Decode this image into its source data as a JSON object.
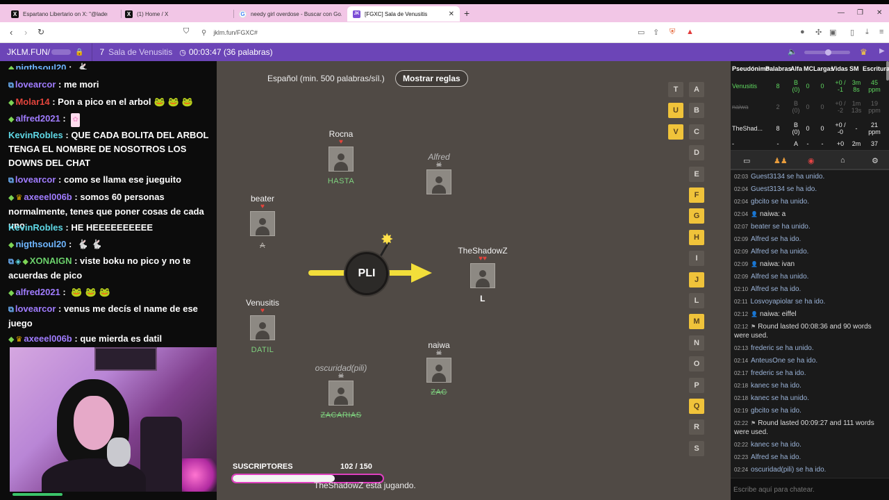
{
  "browser": {
    "tabs": [
      {
        "title": "Espartano Libertario on X: \"@ladere...",
        "icon": "x-logo"
      },
      {
        "title": "(1) Home / X",
        "icon": "x-logo"
      },
      {
        "title": "needy girl overdose - Buscar con Go...",
        "icon": "google-logo"
      },
      {
        "title": "[FGXC] Sala de Venusitis",
        "icon": "jklm-logo"
      }
    ],
    "new_tab": "+",
    "url": "jklm.fun/FGXC#"
  },
  "room_header": {
    "brand": "JKLM.FUN/",
    "room_number": "7",
    "room_name": "Sala de Venusitis",
    "timer": "00:03:47 (36 palabras)"
  },
  "chat_overlay": {
    "messages": [
      {
        "user": "nigthsoul20",
        "text": "",
        "emotes": [
          "bunny"
        ],
        "color": "blue"
      },
      {
        "user": "lovearcor",
        "text": "me mori",
        "emotes": [],
        "color": "purple"
      },
      {
        "user": "Molar14",
        "text": "Pon a pico en el arbol",
        "emotes": [
          "pepe",
          "pepe",
          "pepe"
        ],
        "color": "red"
      },
      {
        "user": "alfred2021",
        "text": "",
        "emotes": [
          "kitty"
        ],
        "color": "purple"
      },
      {
        "user": "KevinRobles",
        "text": "QUE CADA BOLITA DEL ARBOL TENGA EL NOMBRE DE NOSOTROS LOS DOWNS DEL CHAT",
        "emotes": [],
        "color": "cyan"
      },
      {
        "user": "lovearcor",
        "text": "como se llama ese jueguito",
        "emotes": [],
        "color": "purple"
      },
      {
        "user": "axeeel006b",
        "text": "somos 60 personas normalmente, tenes que poner cosas de cada uno",
        "emotes": [],
        "color": "purple"
      },
      {
        "user": "KevinRobles",
        "text": "HE HEEEEEEEEEE",
        "emotes": [],
        "color": "cyan"
      },
      {
        "user": "nigthsoul20",
        "text": "",
        "emotes": [
          "bunny",
          "bunny"
        ],
        "color": "blue"
      },
      {
        "user": "XONAIGN",
        "text": "viste boku no pico y no te acuerdas de pico",
        "emotes": [],
        "color": "green"
      },
      {
        "user": "alfred2021",
        "text": "",
        "emotes": [
          "frog",
          "frog",
          "frog"
        ],
        "color": "purple"
      },
      {
        "user": "lovearcor",
        "text": "venus me decís el name de ese juego",
        "emotes": [],
        "color": "purple"
      },
      {
        "user": "axeeel006b",
        "text": "que mierda es datil",
        "emotes": [],
        "color": "purple"
      }
    ]
  },
  "game": {
    "language_rule": "Español (min. 500 palabras/síl.)",
    "rules_button": "Mostrar reglas",
    "syllable": "PLI",
    "players": [
      {
        "name": "Rocna",
        "lives": 1,
        "word": "HASTA",
        "state": "alive"
      },
      {
        "name": "Alfred",
        "lives": 0,
        "word": "",
        "state": "dead"
      },
      {
        "name": "beater",
        "lives": 1,
        "word": "A",
        "state": "alive"
      },
      {
        "name": "TheShadowZ",
        "lives": 2,
        "word": "L",
        "state": "current"
      },
      {
        "name": "Venusitis",
        "lives": 1,
        "word": "DATIL",
        "state": "alive"
      },
      {
        "name": "naiwa",
        "lives": 0,
        "word": "ZAC",
        "state": "dead"
      },
      {
        "name": "oscuridad(pili)",
        "lives": 0,
        "word": "ZACARIAS",
        "state": "dead"
      }
    ],
    "subscribers": {
      "label": "SUSCRIPTORES",
      "count": "102  / 150",
      "progress": 0.68
    },
    "status_text": "TheShadowZ está jugando.",
    "bonus_letters": [
      "T",
      "U",
      "V"
    ],
    "letters": [
      "A",
      "B",
      "C",
      "D",
      "E",
      "F",
      "G",
      "H",
      "I",
      "J",
      "L",
      "M",
      "N",
      "O",
      "P",
      "Q",
      "R",
      "S"
    ],
    "letters_on": [
      "U",
      "V",
      "F",
      "G",
      "H",
      "J",
      "M",
      "Q"
    ]
  },
  "scoreboard": {
    "headers": [
      "Pseudónimo",
      "Palabras",
      "Alfa",
      "MC",
      "Largas",
      "Vidas",
      "SM",
      "Escritura"
    ],
    "rows": [
      {
        "name": "Venusitis",
        "palabras": "8",
        "alfa": "B (0)",
        "mc": "0",
        "largas": "0",
        "vidas": "+0 / -1",
        "sm": "3m 8s",
        "escritura": "45 ppm",
        "style": "lead"
      },
      {
        "name": "naiwa",
        "palabras": "2",
        "alfa": "B (0)",
        "mc": "0",
        "largas": "0",
        "vidas": "+0 / -2",
        "sm": "1m 13s",
        "escritura": "19 ppm",
        "style": "gone"
      },
      {
        "name": "TheShad...",
        "palabras": "8",
        "alfa": "B (0)",
        "mc": "0",
        "largas": "0",
        "vidas": "+0 / -0",
        "sm": "-",
        "escritura": "21 ppm",
        "style": "normal"
      },
      {
        "name": "-",
        "palabras": "-",
        "alfa": "A",
        "mc": "-",
        "largas": "-",
        "vidas": "+0",
        "sm": "2m",
        "escritura": "37",
        "style": "cut"
      }
    ]
  },
  "log": [
    {
      "time": "02:03",
      "text": "Guest3134 se ha unido.",
      "type": "event"
    },
    {
      "time": "02:04",
      "text": "Guest3134 se ha ido.",
      "type": "event"
    },
    {
      "time": "02:04",
      "text": "gbcito se ha unido.",
      "type": "event"
    },
    {
      "time": "02:04",
      "text": "naiwa: a",
      "type": "chat"
    },
    {
      "time": "02:07",
      "text": "beater se ha unido.",
      "type": "event"
    },
    {
      "time": "02:09",
      "text": "Alfred  se ha ido.",
      "type": "event"
    },
    {
      "time": "02:09",
      "text": "Alfred  se ha unido.",
      "type": "event"
    },
    {
      "time": "02:09",
      "text": "naiwa: ivan",
      "type": "chat"
    },
    {
      "time": "02:09",
      "text": "Alfred  se ha unido.",
      "type": "event"
    },
    {
      "time": "02:10",
      "text": "Alfred  se ha ido.",
      "type": "event"
    },
    {
      "time": "02:11",
      "text": "Losvoyapiolar se ha ido.",
      "type": "event"
    },
    {
      "time": "02:12",
      "text": "naiwa: eiffel",
      "type": "chat"
    },
    {
      "time": "02:12",
      "text": "Round lasted 00:08:36 and 90 words were used.",
      "type": "round"
    },
    {
      "time": "02:13",
      "text": "frederic se ha unido.",
      "type": "event"
    },
    {
      "time": "02:14",
      "text": "AnteusOne se ha ido.",
      "type": "event"
    },
    {
      "time": "02:17",
      "text": "frederic se ha ido.",
      "type": "event"
    },
    {
      "time": "02:18",
      "text": "kanec se ha ido.",
      "type": "event"
    },
    {
      "time": "02:18",
      "text": "kanec se ha unido.",
      "type": "event"
    },
    {
      "time": "02:19",
      "text": "gbcito se ha ido.",
      "type": "event"
    },
    {
      "time": "02:22",
      "text": "Round lasted 00:09:27 and 111 words were used.",
      "type": "round"
    },
    {
      "time": "02:22",
      "text": "kanec se ha ido.",
      "type": "event"
    },
    {
      "time": "02:23",
      "text": "Alfred  se ha ido.",
      "type": "event"
    },
    {
      "time": "02:24",
      "text": "oscuridad(pili) se ha ido.",
      "type": "event"
    }
  ],
  "chat_input": {
    "placeholder": "Escribe aquí para chatear."
  }
}
